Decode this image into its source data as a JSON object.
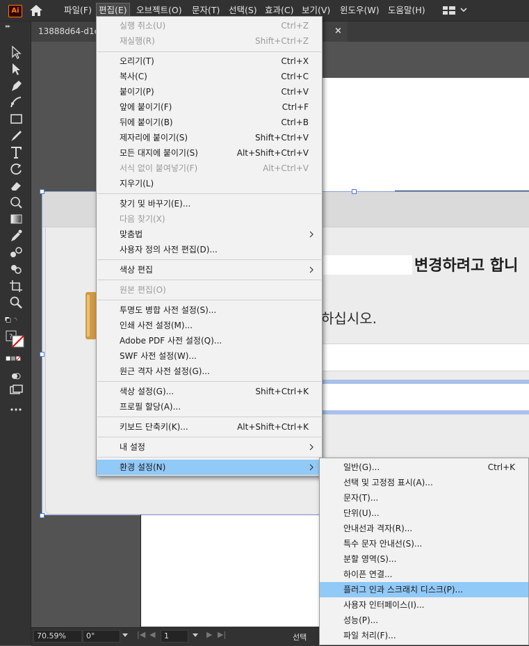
{
  "app": {
    "logo_text": "Ai"
  },
  "menubar": {
    "items": [
      {
        "label": "파일(F)"
      },
      {
        "label": "편집(E)"
      },
      {
        "label": "오브젝트(O)"
      },
      {
        "label": "문자(T)"
      },
      {
        "label": "선택(S)"
      },
      {
        "label": "효과(C)"
      },
      {
        "label": "보기(V)"
      },
      {
        "label": "윈도우(W)"
      },
      {
        "label": "도움말(H)"
      }
    ],
    "active_item": "편집(E)"
  },
  "document_tab": {
    "name": "13888d64-d1e",
    "close_glyph": "×"
  },
  "edit_menu": {
    "items": [
      {
        "label": "실행 취소(U)",
        "shortcut": "Ctrl+Z",
        "disabled": true
      },
      {
        "label": "재실행(R)",
        "shortcut": "Shift+Ctrl+Z",
        "disabled": true
      },
      {
        "label": "오리기(T)",
        "shortcut": "Ctrl+X"
      },
      {
        "label": "복사(C)",
        "shortcut": "Ctrl+C"
      },
      {
        "label": "붙이기(P)",
        "shortcut": "Ctrl+V"
      },
      {
        "label": "앞에 붙이기(F)",
        "shortcut": "Ctrl+F"
      },
      {
        "label": "뒤에 붙이기(B)",
        "shortcut": "Ctrl+B"
      },
      {
        "label": "제자리에 붙이기(S)",
        "shortcut": "Shift+Ctrl+V"
      },
      {
        "label": "모든 대지에 붙이기(S)",
        "shortcut": "Alt+Shift+Ctrl+V"
      },
      {
        "label": "서식 없이 붙여넣기(F)",
        "shortcut": "Alt+Ctrl+V",
        "disabled": true
      },
      {
        "label": "지우기(L)",
        "shortcut": ""
      },
      {
        "label": "찾기 및 바꾸기(E)...",
        "shortcut": ""
      },
      {
        "label": "다음 찾기(X)",
        "shortcut": "",
        "disabled": true
      },
      {
        "label": "맞춤법",
        "shortcut": "",
        "submenu": true
      },
      {
        "label": "사용자 정의 사전 편집(D)...",
        "shortcut": ""
      },
      {
        "label": "색상 편집",
        "shortcut": "",
        "submenu": true
      },
      {
        "label": "원본 편집(O)",
        "shortcut": "",
        "disabled": true
      },
      {
        "label": "투명도 병합 사전 설정(S)...",
        "shortcut": ""
      },
      {
        "label": "인쇄 사전 설정(M)...",
        "shortcut": ""
      },
      {
        "label": "Adobe PDF 사전 설정(Q)...",
        "shortcut": ""
      },
      {
        "label": "SWF 사전 설정(W)...",
        "shortcut": ""
      },
      {
        "label": "원근 격자 사전 설정(G)...",
        "shortcut": ""
      },
      {
        "label": "색상 설정(G)...",
        "shortcut": "Shift+Ctrl+K"
      },
      {
        "label": "프로필 할당(A)...",
        "shortcut": ""
      },
      {
        "label": "키보드 단축키(K)...",
        "shortcut": "Alt+Shift+Ctrl+K"
      },
      {
        "label": "내 설정",
        "shortcut": "",
        "submenu": true
      },
      {
        "label": "환경 설정(N)",
        "shortcut": "",
        "submenu": true,
        "highlighted": true
      }
    ]
  },
  "preferences_submenu": {
    "items": [
      {
        "label": "일반(G)...",
        "shortcut": "Ctrl+K"
      },
      {
        "label": "선택 및 고정점 표시(A)...",
        "shortcut": ""
      },
      {
        "label": "문자(T)...",
        "shortcut": ""
      },
      {
        "label": "단위(U)...",
        "shortcut": ""
      },
      {
        "label": "안내선과 격자(R)...",
        "shortcut": ""
      },
      {
        "label": "특수 문자 안내선(S)...",
        "shortcut": ""
      },
      {
        "label": "분할 영역(S)...",
        "shortcut": ""
      },
      {
        "label": "하이픈 연결...",
        "shortcut": ""
      },
      {
        "label": "플러그 인과 스크래치 디스크(P)...",
        "shortcut": "",
        "highlighted": true
      },
      {
        "label": "사용자 인터페이스(I)...",
        "shortcut": ""
      },
      {
        "label": "성능(P)...",
        "shortcut": ""
      },
      {
        "label": "파일 처리(F)...",
        "shortcut": ""
      }
    ]
  },
  "canvas_image": {
    "heading_fragment": "변경하려고 합니",
    "message_fragment": "하십시오."
  },
  "statusbar": {
    "zoom": "70.59%",
    "rotation": "0°",
    "artboard_number": "1",
    "mode": "선택"
  },
  "colors": {
    "menu_highlight": "#91c9f7",
    "app_orange": "#ff7c00",
    "chrome_dark": "#323232"
  },
  "icons": {
    "toolbar": [
      "selection-tool-icon",
      "direct-selection-tool-icon",
      "pen-tool-icon",
      "curvature-tool-icon",
      "rectangle-tool-icon",
      "paintbrush-tool-icon",
      "type-tool-icon",
      "rotate-tool-icon",
      "eraser-tool-icon",
      "warp-tool-icon",
      "gradient-tool-icon",
      "eyedropper-tool-icon",
      "blend-tool-icon",
      "shape-builder-tool-icon",
      "artboard-tool-icon",
      "zoom-tool-icon"
    ]
  }
}
